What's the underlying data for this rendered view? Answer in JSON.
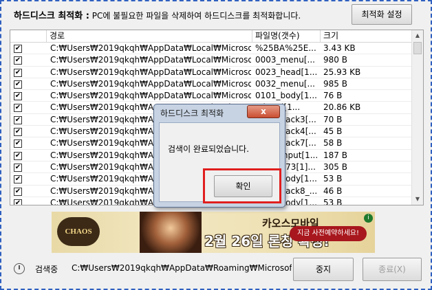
{
  "header": {
    "title": "하드디스크 최적화 :",
    "description": "PC에 불필요한 파일을 삭제하여 하드디스크를 최적화합니다.",
    "settings_button": "최적화 설정"
  },
  "table": {
    "columns": [
      "경로",
      "파일명(갯수)",
      "크기"
    ],
    "rows": [
      {
        "checked": true,
        "path": "C:₩Users₩2019qkqh₩AppData₩Local₩Microsoft...",
        "name": "%25BA%25E...",
        "size": "3.43 KB"
      },
      {
        "checked": true,
        "path": "C:₩Users₩2019qkqh₩AppData₩Local₩Microsoft...",
        "name": "0003_menu[...",
        "size": "980 B"
      },
      {
        "checked": true,
        "path": "C:₩Users₩2019qkqh₩AppData₩Local₩Microsoft...",
        "name": "0023_head[1...",
        "size": "25.93 KB"
      },
      {
        "checked": true,
        "path": "C:₩Users₩2019qkqh₩AppData₩Local₩Microsoft...",
        "name": "0032_menu[...",
        "size": "985 B"
      },
      {
        "checked": true,
        "path": "C:₩Users₩2019qkqh₩AppData₩Local₩Microsoft...",
        "name": "0101_body[1...",
        "size": "76 B"
      },
      {
        "checked": true,
        "path": "C:₩Users₩2019qkqh₩AppData₩Local₩Microsoft...",
        "name": "...head[1...",
        "size": "20.86 KB"
      },
      {
        "checked": true,
        "path": "C:₩Users₩2019qkqh₩AppData₩Local₩Microsoft...",
        "name": "0108_back3[...",
        "size": "70 B"
      },
      {
        "checked": true,
        "path": "C:₩Users₩2019qkqh₩AppData₩Local₩Microsoft...",
        "name": "0108_back4[...",
        "size": "45 B"
      },
      {
        "checked": true,
        "path": "C:₩Users₩2019qkqh₩AppData₩Local₩Microsoft...",
        "name": "0108_back7[...",
        "size": "58 B"
      },
      {
        "checked": true,
        "path": "C:₩Users₩2019qkqh₩AppData₩Local₩Microsoft...",
        "name": "0111_input[1...",
        "size": "187 B"
      },
      {
        "checked": true,
        "path": "C:₩Users₩2019qkqh₩AppData₩Local₩Microsoft...",
        "name": "0111_773[1]...",
        "size": "305 B"
      },
      {
        "checked": true,
        "path": "C:₩Users₩2019qkqh₩AppData₩Local₩Microsoft...",
        "name": "0112_body[1...",
        "size": "53 B"
      },
      {
        "checked": true,
        "path": "C:₩Users₩2019qkqh₩AppData₩Local₩Microsoft...",
        "name": "0112_back8_...",
        "size": "46 B"
      },
      {
        "checked": true,
        "path": "C:₩Users₩2019qkqh₩AppData₩Local₩Microsoft...",
        "name": "0112_body[1...",
        "size": "53 B"
      }
    ]
  },
  "banner": {
    "logo_text": "CHAOS MOBILE",
    "game_name": "카오스모바일",
    "launch_text": "2월 26일 론칭 확정!",
    "cta": "지금 사전예약하세요!",
    "info_icon": "i"
  },
  "status": {
    "label": "검색중",
    "current_path": "C:₩Users₩2019qkqh₩AppData₩Roaming₩Microsoft₩Wi",
    "stop_button": "중지",
    "end_button": "종료(X)"
  },
  "dialog": {
    "title": "하드디스크 최적화",
    "close_glyph": "x",
    "message": "검색이 완료되었습니다.",
    "confirm_button": "확인"
  },
  "icons": {
    "check": "✔",
    "scroll_up": "▲",
    "scroll_down": "▼"
  },
  "colors": {
    "frame_border": "#2f5fbf",
    "highlight_border": "#e01e1e",
    "dialog_close": "#c94e32"
  }
}
